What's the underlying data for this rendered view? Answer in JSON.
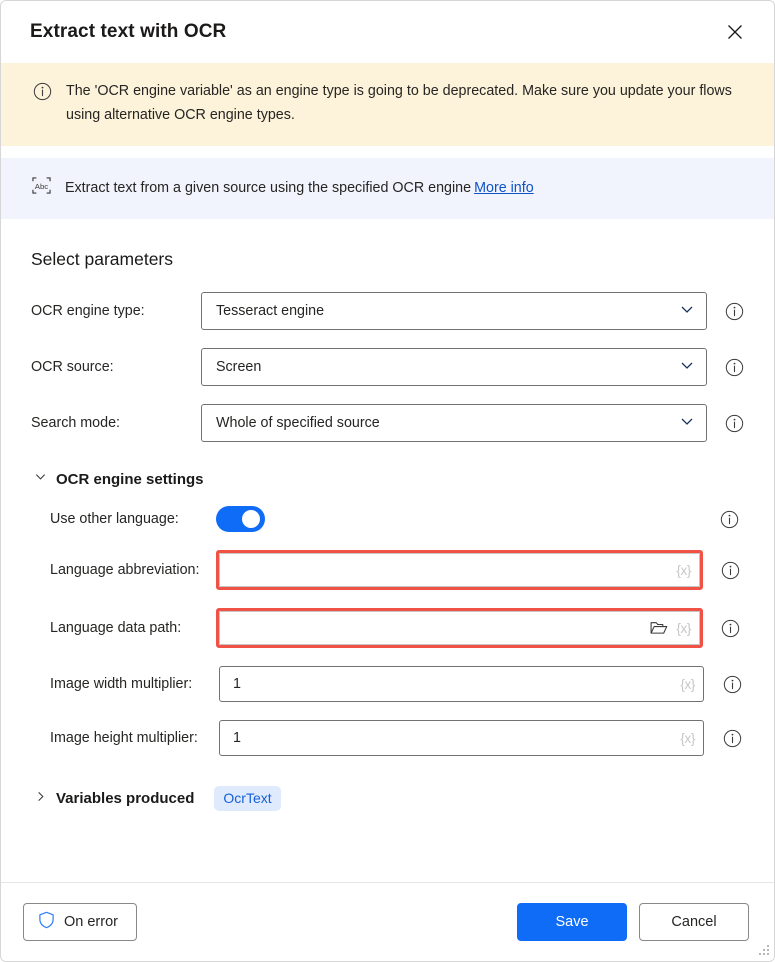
{
  "window": {
    "title": "Extract text with OCR",
    "close_icon": "close-icon"
  },
  "warning_banner": {
    "icon": "info-circle-icon",
    "text": "The 'OCR engine variable' as an engine type is going to be deprecated.  Make sure you update your flows using alternative OCR engine types.",
    "background": "#fdf3da"
  },
  "info_strip": {
    "icon": "abc-ocr-icon",
    "text": "Extract text from a given source using the specified OCR engine",
    "link_label": "More info",
    "link_color": "#0f53c7",
    "background": "#f1f4fd"
  },
  "parameters": {
    "heading": "Select parameters",
    "fields": [
      {
        "label": "OCR engine type:",
        "value": "Tesseract engine",
        "control": "dropdown"
      },
      {
        "label": "OCR source:",
        "value": "Screen",
        "control": "dropdown"
      },
      {
        "label": "Search mode:",
        "value": "Whole of specified source",
        "control": "dropdown"
      }
    ]
  },
  "engine_settings": {
    "header": "OCR engine settings",
    "expanded": true,
    "chevron": "chevron-down-icon",
    "toggle": {
      "label": "Use other language:",
      "state": "on",
      "color": "#0f6cf7"
    },
    "language_abbreviation": {
      "label": "Language abbreviation:",
      "value": "",
      "variable_glyph": "{x}",
      "error": true
    },
    "language_data_path": {
      "label": "Language data path:",
      "value": "",
      "variable_glyph": "{x}",
      "folder_icon": "folder-open-icon",
      "error": true
    },
    "image_width_multiplier": {
      "label": "Image width multiplier:",
      "value": "1",
      "variable_glyph": "{x}"
    },
    "image_height_multiplier": {
      "label": "Image height multiplier:",
      "value": "1",
      "variable_glyph": "{x}"
    },
    "error_border_color": "#f05245"
  },
  "variables_produced": {
    "header": "Variables produced",
    "chevron": "chevron-right-icon",
    "badge": "OcrText",
    "badge_bg": "#dfeafd",
    "badge_color": "#1560d6"
  },
  "footer": {
    "on_error_label": "On error",
    "on_error_icon": "shield-icon",
    "save_label": "Save",
    "cancel_label": "Cancel",
    "primary_color": "#0f6cf7"
  }
}
